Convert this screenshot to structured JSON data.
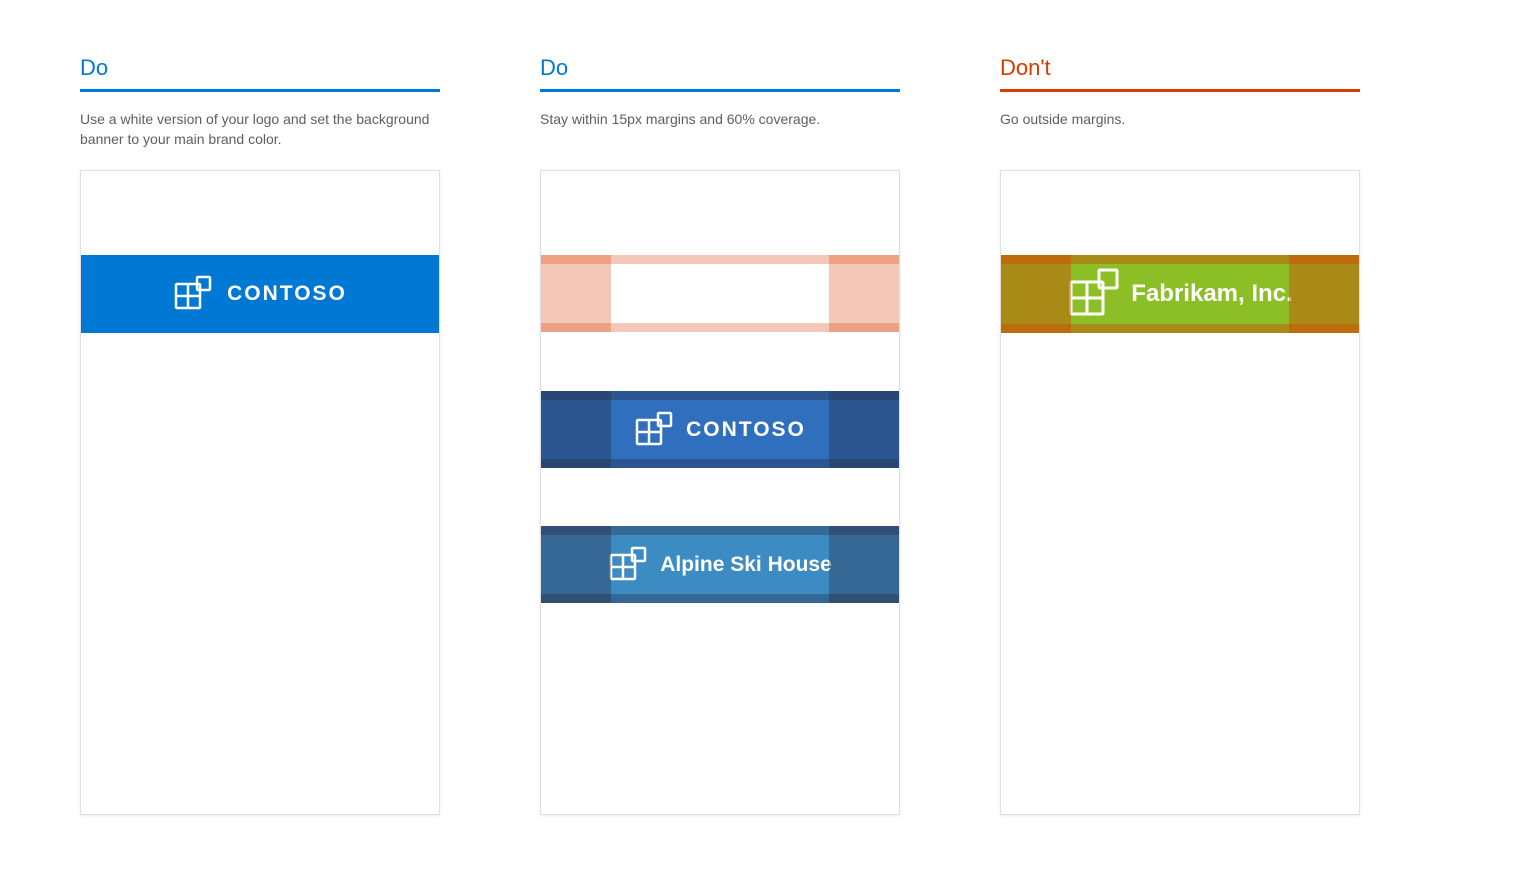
{
  "columns": [
    {
      "heading": "Do",
      "type": "do",
      "description": "Use a white version of your logo and set the background banner to your main brand color.",
      "banners": [
        {
          "brand": "CONTOSO",
          "bg": "#0078d4"
        }
      ]
    },
    {
      "heading": "Do",
      "type": "do",
      "description": "Stay within 15px margins and 60% coverage.",
      "banners": [
        {
          "brand": "",
          "bg": "#ffffff",
          "overlay": "red"
        },
        {
          "brand": "CONTOSO",
          "bg": "#2f6fbd",
          "overlay": "dim"
        },
        {
          "brand": "Alpine Ski House",
          "bg": "#3d8bc3",
          "overlay": "dim"
        }
      ]
    },
    {
      "heading": "Don't",
      "type": "dont",
      "description": "Go outside margins.",
      "banners": [
        {
          "brand": "Fabrikam, Inc.",
          "bg": "#8cbf26",
          "overlay": "red-dont"
        }
      ]
    }
  ]
}
